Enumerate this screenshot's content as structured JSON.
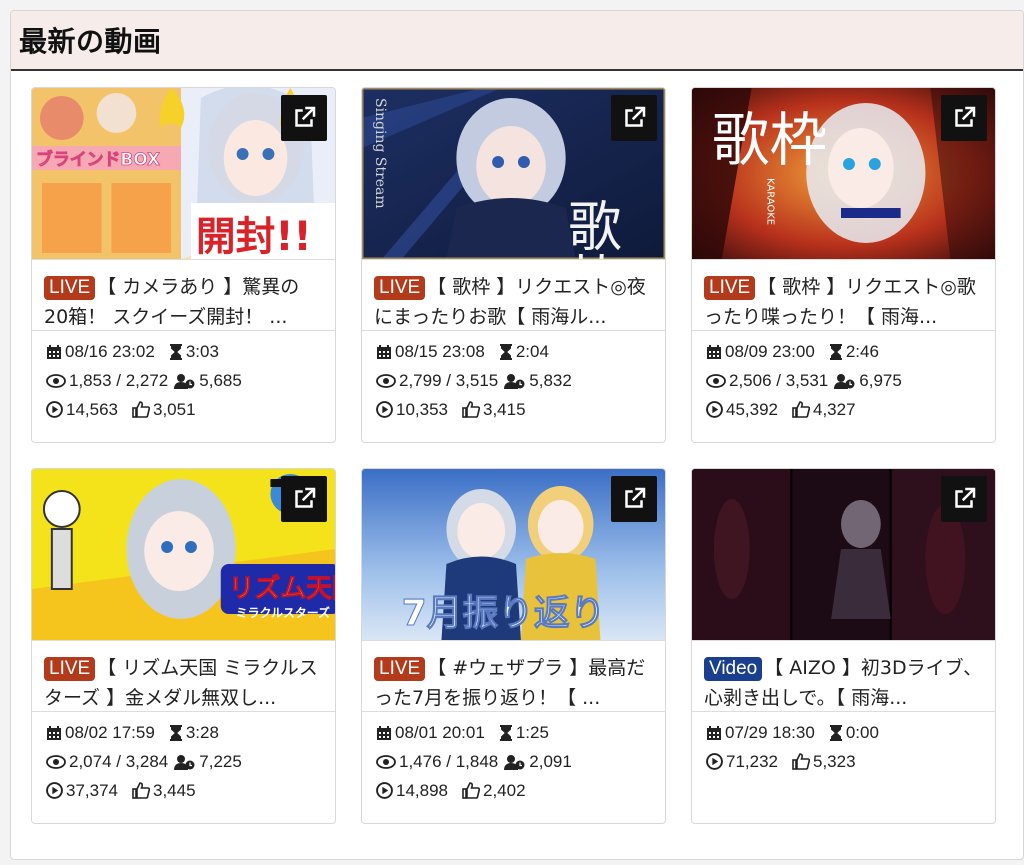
{
  "section": {
    "title": "最新の動画"
  },
  "videos": [
    {
      "badge": "LIVE",
      "badge_type": "live",
      "title": "【 カメラあり 】驚異の20箱！ スクイーズ開封！ ...",
      "date": "08/16 23:02",
      "duration": "3:03",
      "views": "1,853 / 2,272",
      "members": "5,685",
      "plays": "14,563",
      "likes": "3,051",
      "thumb_overlay": "開封!!",
      "thumb_sub": "ブラインドBOX"
    },
    {
      "badge": "LIVE",
      "badge_type": "live",
      "title": "【 歌枠 】リクエスト◎夜にまったりお歌【 雨海ル...",
      "date": "08/15 23:08",
      "duration": "2:04",
      "views": "2,799 / 3,515",
      "members": "5,832",
      "plays": "10,353",
      "likes": "3,415",
      "thumb_overlay": "歌枠",
      "thumb_sub": "Singing Stream"
    },
    {
      "badge": "LIVE",
      "badge_type": "live",
      "title": "【 歌枠 】リクエスト◎歌ったり喋ったり！【 雨海...",
      "date": "08/09 23:00",
      "duration": "2:46",
      "views": "2,506 / 3,531",
      "members": "6,975",
      "plays": "45,392",
      "likes": "4,327",
      "thumb_overlay": "歌枠",
      "thumb_sub": "KARAOKE"
    },
    {
      "badge": "LIVE",
      "badge_type": "live",
      "title": "【 リズム天国 ミラクルスターズ 】金メダル無双し...",
      "date": "08/02 17:59",
      "duration": "3:28",
      "views": "2,074 / 3,284",
      "members": "7,225",
      "plays": "37,374",
      "likes": "3,445",
      "thumb_overlay": "リズム天国",
      "thumb_sub": "ミラクルスターズ"
    },
    {
      "badge": "LIVE",
      "badge_type": "live",
      "title": "【 #ウェザプラ 】最高だった7月を振り返り！【 ...",
      "date": "08/01 20:01",
      "duration": "1:25",
      "views": "1,476 / 1,848",
      "members": "2,091",
      "plays": "14,898",
      "likes": "2,402",
      "thumb_overlay": "7月振り返り",
      "thumb_sub": ""
    },
    {
      "badge": "Video",
      "badge_type": "video",
      "title": "【 AIZO 】初3Dライブ、心剥き出しで。【 雨海...",
      "date": "07/29 18:30",
      "duration": "0:00",
      "views": "",
      "members": "",
      "plays": "71,232",
      "likes": "5,323",
      "thumb_overlay": "",
      "thumb_sub": ""
    }
  ],
  "icons": {
    "external": "external-link-icon",
    "calendar": "calendar-icon",
    "hourglass": "hourglass-icon",
    "eye": "eye-icon",
    "members": "members-icon",
    "play": "play-circle-icon",
    "like": "thumbs-up-icon"
  },
  "colors": {
    "live_badge": "#b33a1a",
    "video_badge": "#1b3f8f",
    "header_bg": "#f6ecea"
  }
}
